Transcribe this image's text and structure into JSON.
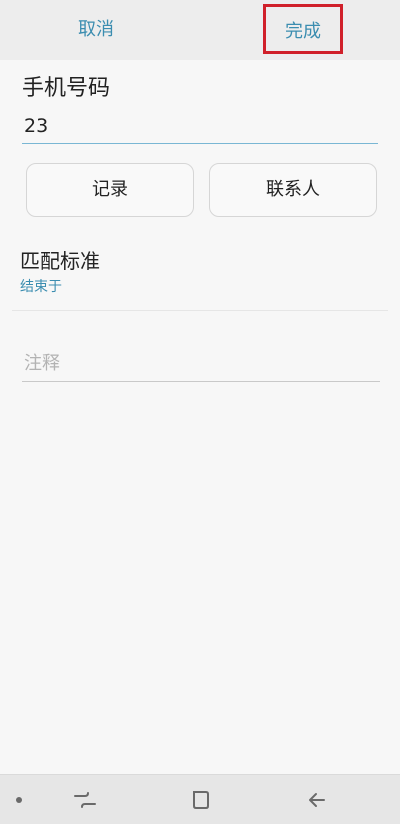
{
  "topbar": {
    "cancel_label": "取消",
    "done_label": "完成"
  },
  "phone": {
    "label": "手机号码",
    "value": "23"
  },
  "actions": {
    "records_label": "记录",
    "contacts_label": "联系人"
  },
  "match": {
    "title": "匹配标准",
    "value": "结束于"
  },
  "note": {
    "placeholder": "注释"
  },
  "navbar": {
    "icons": [
      "dot-icon",
      "recent-apps-icon",
      "home-icon",
      "back-icon"
    ]
  },
  "colors": {
    "accent": "#3b8db0",
    "highlight_border": "#d0202a",
    "background": "#f7f7f7"
  }
}
